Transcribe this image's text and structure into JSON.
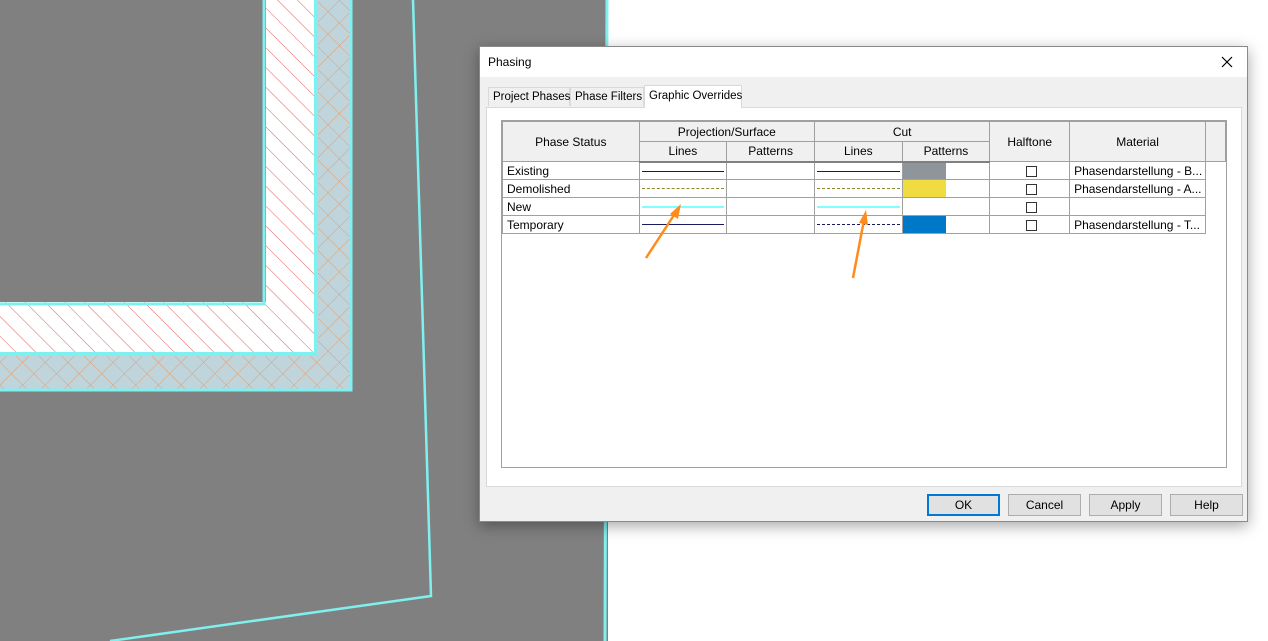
{
  "dialog": {
    "title": "Phasing",
    "close_icon": "close-icon"
  },
  "tabs": [
    {
      "label": "Project Phases",
      "active": false
    },
    {
      "label": "Phase Filters",
      "active": false
    },
    {
      "label": "Graphic Overrides",
      "active": true
    }
  ],
  "grid": {
    "headers": {
      "phase_status": "Phase Status",
      "projection_surface": "Projection/Surface",
      "cut": "Cut",
      "halftone": "Halftone",
      "material": "Material",
      "lines": "Lines",
      "patterns": "Patterns"
    },
    "rows": [
      {
        "status": "Existing",
        "proj_line_color": "#1a1a40",
        "proj_line_style": "solid",
        "cut_line_color": "#1a1a40",
        "cut_line_style": "solid",
        "cut_pattern_color": "#8e969c",
        "halftone": false,
        "material": "Phasendarstellung - B..."
      },
      {
        "status": "Demolished",
        "proj_line_color": "#8a8a2a",
        "proj_line_style": "dashed",
        "cut_line_color": "#8a8a2a",
        "cut_line_style": "dashed",
        "cut_pattern_color": "#f0dc40",
        "halftone": false,
        "material": "Phasendarstellung - A..."
      },
      {
        "status": "New",
        "proj_line_color": "#7fffff",
        "proj_line_style": "solid",
        "cut_line_color": "#7fffff",
        "cut_line_style": "solid",
        "cut_pattern_color": "",
        "halftone": false,
        "material": ""
      },
      {
        "status": "Temporary",
        "proj_line_color": "#1a1a60",
        "proj_line_style": "solid",
        "cut_line_color": "#1a1a60",
        "cut_line_style": "dashed",
        "cut_pattern_color": "#0078c8",
        "halftone": false,
        "material": "Phasendarstellung - T..."
      }
    ]
  },
  "buttons": {
    "ok": "OK",
    "cancel": "Cancel",
    "apply": "Apply",
    "help": "Help"
  },
  "colors": {
    "canvas_gray": "#808080",
    "wall_outline": "#7ff0f0",
    "hatch_red": "#e06060",
    "hatch_orange": "#e0a070",
    "wall_fill": "#c0d4dc",
    "arrow": "#ff8c1a",
    "accent": "#0078d7"
  }
}
